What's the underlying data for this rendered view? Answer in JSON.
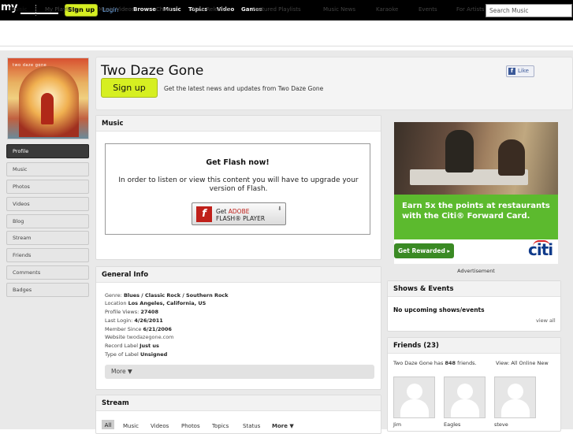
{
  "topbar": {
    "logo": "my",
    "signup": "Sign up",
    "login": "Login",
    "nav": [
      "Browse",
      "Music",
      "Topics",
      "Video",
      "Games"
    ],
    "search_placeholder": "Search Music"
  },
  "subnav": {
    "items": [
      "Music",
      "My Playlists",
      "Music Videos",
      "Charts",
      "New Releases",
      "Featured Playlists",
      "Music News",
      "Karaoke",
      "Events",
      "For Artists"
    ]
  },
  "sidebar": {
    "photo_text": "two daze gone",
    "items": [
      "Profile",
      "Music",
      "Photos",
      "Videos",
      "Blog",
      "Stream",
      "Friends",
      "Comments",
      "Badges"
    ],
    "active": "Profile"
  },
  "header": {
    "artist": "Two Daze Gone",
    "signup": "Sign up",
    "signup_desc": "Get the latest news and updates from Two Daze Gone",
    "like": "Like",
    "like_icon": "f"
  },
  "music_panel": {
    "title": "Music",
    "flash_title": "Get Flash now!",
    "flash_msg": "In order to listen or view this content you will have to upgrade your version of Flash.",
    "badge_get": "Get ",
    "badge_adobe": "ADOBE",
    "badge_player": "FLASH® PLAYER",
    "badge_icon": "f"
  },
  "general_info": {
    "title": "General Info",
    "rows": [
      {
        "label": "Genre: ",
        "value": "Blues / Classic Rock / Southern Rock"
      },
      {
        "label": "Location ",
        "value": "Los Angeles, California, US"
      },
      {
        "label": "Profile Views: ",
        "value": "27408"
      },
      {
        "label": "Last Login: ",
        "value": "4/26/2011"
      },
      {
        "label": "Member Since ",
        "value": "6/21/2006"
      },
      {
        "label": "Website ",
        "value": "twodazegone.com"
      },
      {
        "label": "Record Label ",
        "value": "Just us"
      },
      {
        "label": "Type of Label ",
        "value": "Unsigned"
      }
    ],
    "more": "More ▼"
  },
  "stream": {
    "title": "Stream",
    "tabs": [
      "All",
      "Music",
      "Videos",
      "Photos",
      "Topics",
      "Status",
      "More ▼"
    ]
  },
  "ad": {
    "headline": "Earn 5x the points at restaurants with the Citi® Forward Card.",
    "cta": "Get Rewarded ▸",
    "brand": "citi",
    "label": "Advertisement",
    "colors": {
      "green": "#5cba2e",
      "brand_blue": "#0f3a8a"
    }
  },
  "shows": {
    "title": "Shows & Events",
    "empty": "No upcoming shows/events",
    "view_all": "view all"
  },
  "friends": {
    "title": "Friends (23)",
    "summary_prefix": "Two Daze Gone has ",
    "summary_count": "848",
    "summary_suffix": " friends.",
    "view_label": "View: ",
    "view_all": "All",
    "view_online": "Online",
    "view_new": "New",
    "list": [
      "Jim",
      "Eagles",
      "steve"
    ]
  },
  "colors": {
    "accent": "#d6ef21",
    "topbar": "#000000"
  }
}
